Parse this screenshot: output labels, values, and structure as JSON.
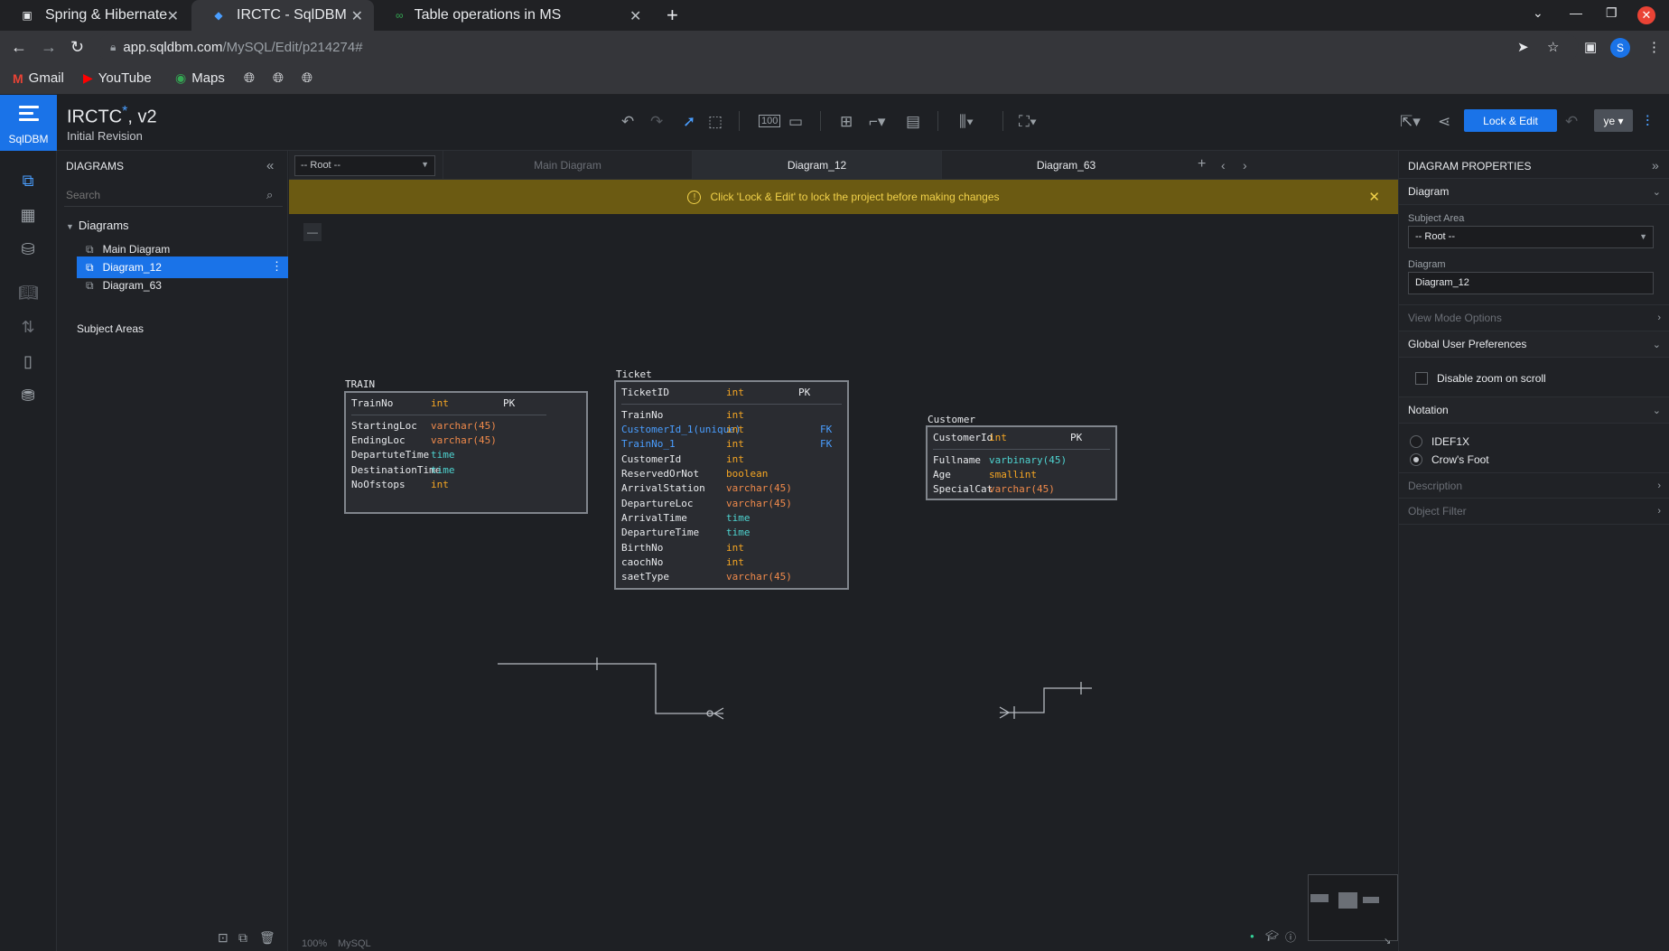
{
  "browser": {
    "tabs": [
      {
        "title": "Spring & Hibernate",
        "icon": "spring-icon"
      },
      {
        "title": "IRCTC - SqlDBM",
        "icon": "sqldbm-icon"
      },
      {
        "title": "Table operations in MS SQ",
        "icon": "link-icon"
      }
    ],
    "url_host": "app.sqldbm.com",
    "url_path": "/MySQL/Edit/p214274#",
    "profile_initial": "S",
    "bookmarks": [
      "Gmail",
      "YouTube",
      "Maps"
    ]
  },
  "app": {
    "logo_text": "SqlDBM",
    "project_name": "IRCTC",
    "project_modified_mark": "*",
    "project_version": ", v2",
    "revision": "Initial Revision",
    "lock_button": "Lock & Edit",
    "user_button": "ye"
  },
  "diagrams_panel": {
    "heading": "DIAGRAMS",
    "search_placeholder": "Search",
    "root_label": "Diagrams",
    "items": [
      "Main Diagram",
      "Diagram_12",
      "Diagram_63"
    ],
    "selected_index": 1,
    "subject_areas": "Subject Areas"
  },
  "canvas": {
    "subject_area_select": "-- Root --",
    "tabs": [
      "Main Diagram",
      "Diagram_12",
      "Diagram_63"
    ],
    "active_tab": "Diagram_12",
    "notice": "Click 'Lock & Edit' to lock the project before making changes",
    "zoom": "100%",
    "db_type": "MySQL"
  },
  "tables": {
    "train": {
      "name": "TRAIN",
      "pk": [
        {
          "name": "TrainNo",
          "type": "int",
          "key": "PK"
        }
      ],
      "columns": [
        {
          "name": "StartingLoc",
          "type": "varchar(45)"
        },
        {
          "name": "EndingLoc",
          "type": "varchar(45)"
        },
        {
          "name": "DepartuteTime",
          "type": "time"
        },
        {
          "name": "DestinationTime",
          "type": "time"
        },
        {
          "name": "NoOfstops",
          "type": "int"
        }
      ]
    },
    "ticket": {
      "name": "Ticket",
      "pk": [
        {
          "name": "TicketID",
          "type": "int",
          "key": "PK"
        }
      ],
      "columns": [
        {
          "name": "TrainNo",
          "type": "int",
          "key": ""
        },
        {
          "name": "CustomerId_1(unique)",
          "type": "int",
          "key": "FK"
        },
        {
          "name": "TrainNo_1",
          "type": "int",
          "key": "FK"
        },
        {
          "name": "CustomerId",
          "type": "int",
          "key": ""
        },
        {
          "name": "ReservedOrNot",
          "type": "boolean",
          "key": ""
        },
        {
          "name": "ArrivalStation",
          "type": "varchar(45)",
          "key": ""
        },
        {
          "name": "DepartureLoc",
          "type": "varchar(45)",
          "key": ""
        },
        {
          "name": "ArrivalTime",
          "type": "time",
          "key": ""
        },
        {
          "name": "DepartureTime",
          "type": "time",
          "key": ""
        },
        {
          "name": "BirthNo",
          "type": "int",
          "key": ""
        },
        {
          "name": "caochNo",
          "type": "int",
          "key": ""
        },
        {
          "name": "saetType",
          "type": "varchar(45)",
          "key": ""
        }
      ]
    },
    "customer": {
      "name": "Customer",
      "pk": [
        {
          "name": "CustomerId",
          "type": "int",
          "key": "PK"
        }
      ],
      "columns": [
        {
          "name": "Fullname",
          "type": "varbinary(45)"
        },
        {
          "name": "Age",
          "type": "smallint"
        },
        {
          "name": "SpecialCat",
          "type": "varchar(45)"
        }
      ]
    }
  },
  "properties": {
    "heading": "DIAGRAM PROPERTIES",
    "section_diagram": "Diagram",
    "subject_area_label": "Subject Area",
    "subject_area_value": "-- Root --",
    "diagram_label": "Diagram",
    "diagram_value": "Diagram_12",
    "view_mode": "View Mode Options",
    "global_prefs": "Global User Preferences",
    "disable_zoom": "Disable zoom on scroll",
    "notation": "Notation",
    "notation_options": [
      "IDEF1X",
      "Crow's Foot"
    ],
    "notation_selected": "Crow's Foot",
    "description": "Description",
    "object_filter": "Object Filter"
  },
  "colors": {
    "accent": "#1a73e8",
    "notice_bg": "#6b5a12",
    "notice_text": "#f2d24a",
    "type_int": "#f6a623",
    "type_varchar": "#f08a4b",
    "type_time": "#4ed3d0",
    "fk": "#4a9eff"
  }
}
